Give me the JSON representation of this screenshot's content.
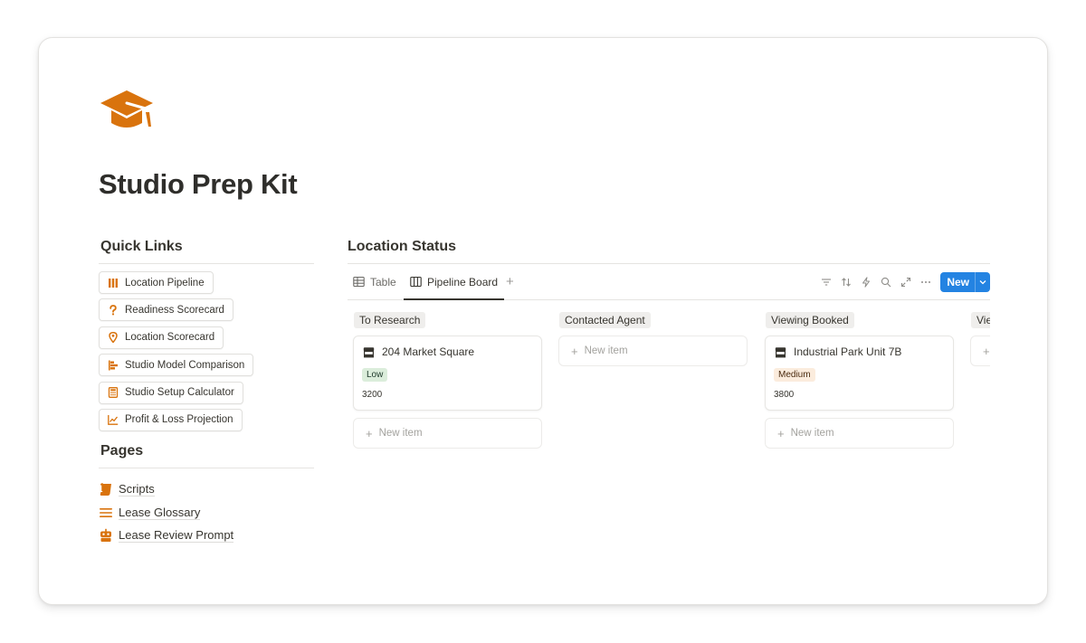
{
  "page": {
    "title": "Studio Prep Kit",
    "icon": "graduation-cap-icon",
    "accent_color": "#d9730d"
  },
  "quick_links": {
    "heading": "Quick Links",
    "items": [
      {
        "label": "Location Pipeline",
        "icon": "columns-icon"
      },
      {
        "label": "Readiness Scorecard",
        "icon": "question-mark-icon"
      },
      {
        "label": "Location Scorecard",
        "icon": "map-pin-icon"
      },
      {
        "label": "Studio Model Comparison",
        "icon": "gantt-icon"
      },
      {
        "label": "Studio Setup Calculator",
        "icon": "calculator-icon"
      },
      {
        "label": "Profit & Loss Projection",
        "icon": "line-chart-icon"
      }
    ]
  },
  "pages": {
    "heading": "Pages",
    "items": [
      {
        "label": "Scripts",
        "icon": "scroll-icon"
      },
      {
        "label": "Lease Glossary",
        "icon": "list-icon"
      },
      {
        "label": "Lease Review Prompt",
        "icon": "robot-icon"
      }
    ]
  },
  "database": {
    "title": "Location Status",
    "tabs": [
      {
        "label": "Table",
        "icon": "table-icon",
        "active": false
      },
      {
        "label": "Pipeline Board",
        "icon": "board-icon",
        "active": true
      }
    ],
    "add_view": "+",
    "toolbar": {
      "tools": [
        "filter-icon",
        "sort-icon",
        "automation-icon",
        "search-icon",
        "expand-icon",
        "more-icon"
      ],
      "new_label": "New",
      "new_color": "#2383e2"
    },
    "new_item_label": "New item",
    "columns": [
      {
        "name": "To Research",
        "cards": [
          {
            "title": "204 Market Square",
            "icon": "storefront-icon",
            "priority": "Low",
            "priority_bg": "#dbeddb",
            "priority_fg": "#1c3829",
            "value": "3200"
          }
        ]
      },
      {
        "name": "Contacted Agent",
        "cards": []
      },
      {
        "name": "Viewing Booked",
        "cards": [
          {
            "title": "Industrial Park Unit 7B",
            "icon": "storefront-icon",
            "priority": "Medium",
            "priority_bg": "#fbecdd",
            "priority_fg": "#49290e",
            "value": "3800"
          }
        ]
      },
      {
        "name": "Vie",
        "cards": []
      }
    ]
  }
}
